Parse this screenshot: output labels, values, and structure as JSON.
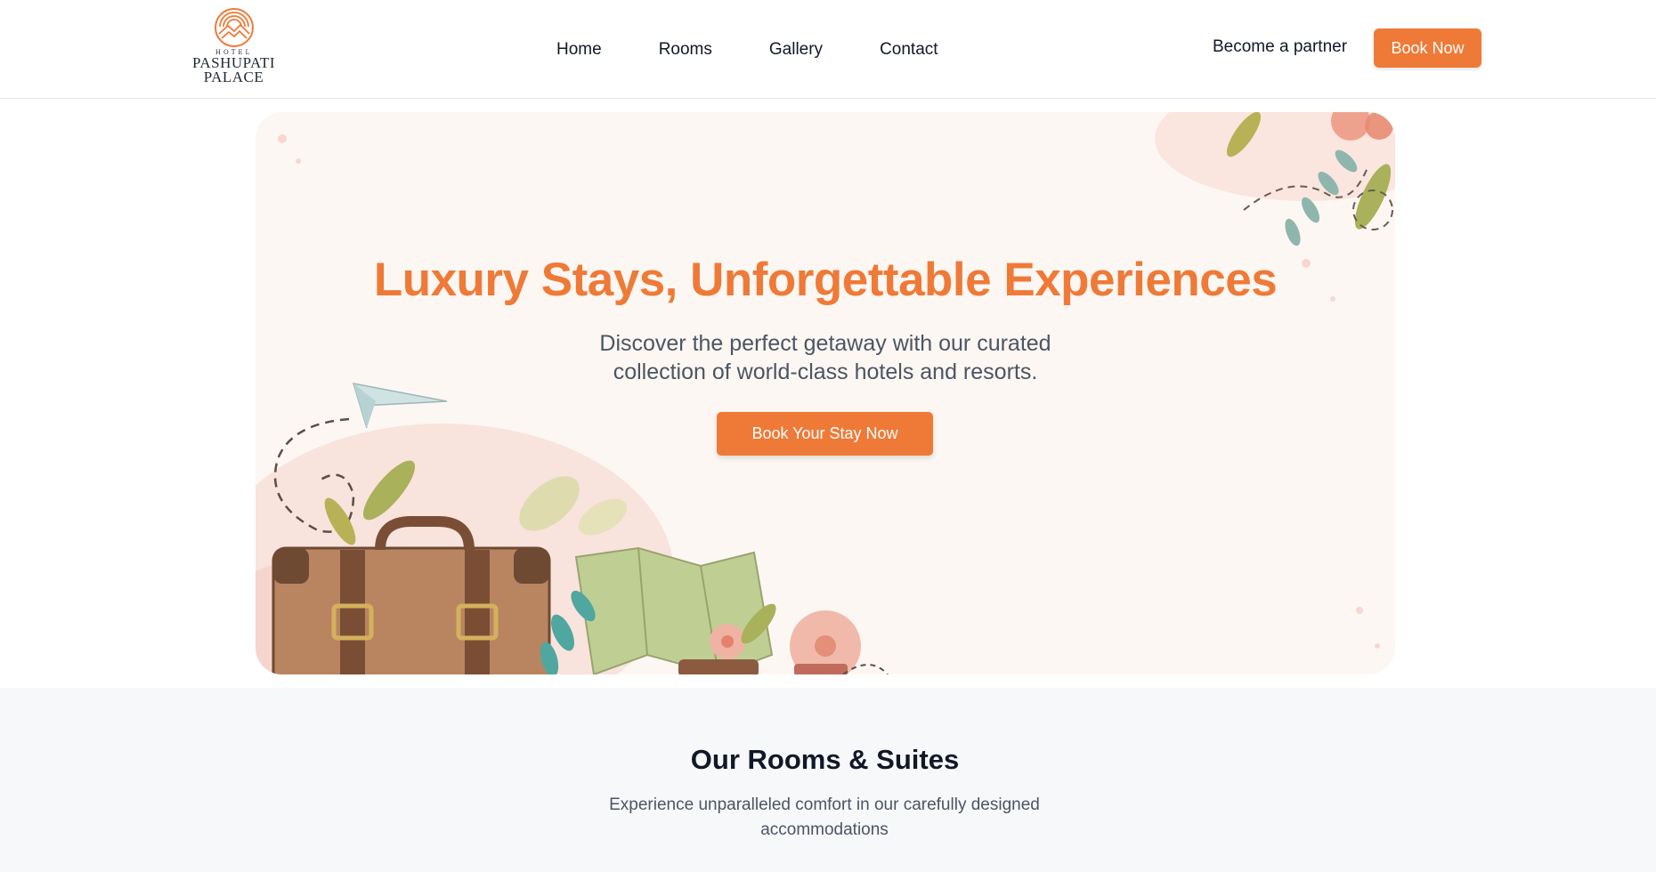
{
  "header": {
    "logo": {
      "small": "HOTEL",
      "line1": "PASHUPATI",
      "line2": "PALACE",
      "icon": "mountain-sun-logo-icon"
    },
    "nav": [
      {
        "label": "Home"
      },
      {
        "label": "Rooms"
      },
      {
        "label": "Gallery"
      },
      {
        "label": "Contact"
      }
    ],
    "partner_label": "Become a partner",
    "book_label": "Book Now"
  },
  "hero": {
    "title": "Luxury Stays, Unforgettable Experiences",
    "subtitle_line1": "Discover the perfect getaway with our curated",
    "subtitle_line2": "collection of world-class hotels and resorts.",
    "cta_label": "Book Your Stay Now",
    "illustration": [
      "paper-plane-icon",
      "suitcase-illustration",
      "map-illustration",
      "flowers-illustration",
      "leaves-illustration"
    ]
  },
  "rooms": {
    "title": "Our Rooms & Suites",
    "subtitle_line1": "Experience unparalleled comfort in our carefully designed",
    "subtitle_line2": "accommodations"
  },
  "colors": {
    "accent": "#ef7a37",
    "hero_bg": "#fdf7f3",
    "section_bg": "#f7f8fa",
    "text_dark": "#111827",
    "text_muted": "#4b5563"
  }
}
